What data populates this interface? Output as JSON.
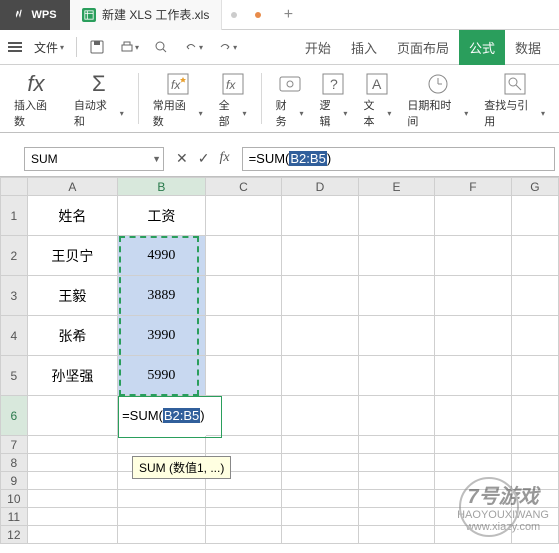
{
  "titlebar": {
    "app_name": "WPS",
    "tab_name": "新建 XLS 工作表.xls"
  },
  "menubar": {
    "file": "文件",
    "tabs": {
      "start": "开始",
      "insert": "插入",
      "layout": "页面布局",
      "formula": "公式",
      "data": "数据"
    }
  },
  "ribbon": {
    "insert_fn": "插入函数",
    "autosum": "自动求和",
    "common": "常用函数",
    "all": "全部",
    "finance": "财务",
    "logic": "逻辑",
    "text": "文本",
    "datetime": "日期和时间",
    "lookup": "查找与引用"
  },
  "formula_bar": {
    "name_box": "SUM",
    "formula_prefix": "=SUM(",
    "formula_sel": "B2:B5",
    "formula_suffix": ")"
  },
  "grid": {
    "cols": [
      "A",
      "B",
      "C",
      "D",
      "E",
      "F",
      "G"
    ],
    "header": {
      "A": "姓名",
      "B": "工资"
    },
    "rows": [
      {
        "A": "王贝宁",
        "B": "4990"
      },
      {
        "A": "王毅",
        "B": "3889"
      },
      {
        "A": "张希",
        "B": "3990"
      },
      {
        "A": "孙坚强",
        "B": "5990"
      }
    ],
    "active_cell_prefix": "=SUM(",
    "active_cell_sel": "B2:B5",
    "active_cell_suffix": ")",
    "tooltip": "SUM (数值1, ...)"
  },
  "watermark": {
    "line1": "7号游戏",
    "line2": "HAOYOUXIWANG",
    "url": "www.xiazy.com"
  },
  "chart_data": {
    "type": "table",
    "columns": [
      "姓名",
      "工资"
    ],
    "rows": [
      [
        "王贝宁",
        4990
      ],
      [
        "王毅",
        3889
      ],
      [
        "张希",
        3990
      ],
      [
        "孙坚强",
        5990
      ]
    ],
    "formula": "=SUM(B2:B5)",
    "formula_target_cell": "B6"
  }
}
